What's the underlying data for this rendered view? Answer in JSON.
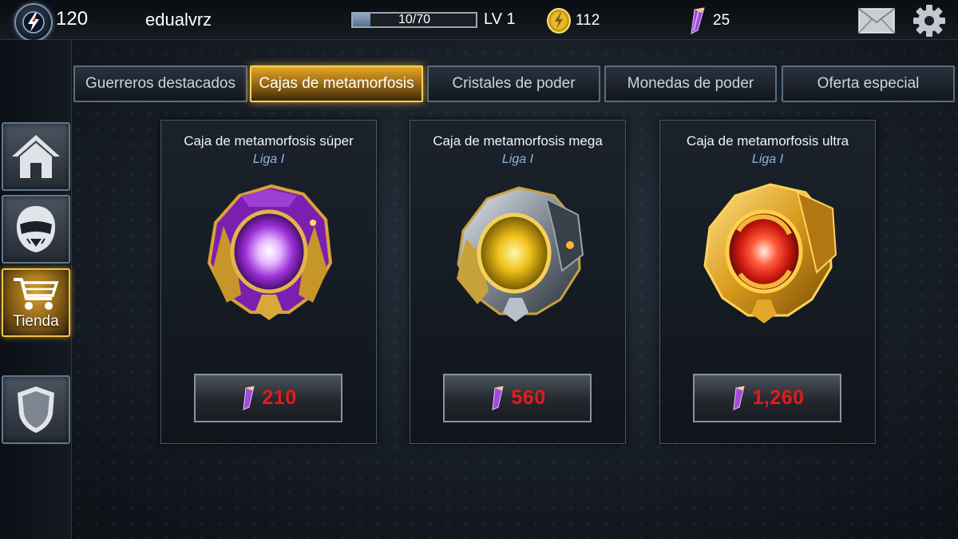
{
  "header": {
    "power_level": "120",
    "username": "edualvrz",
    "xp_text": "10/70",
    "xp_progress": 0.143,
    "level": "LV 1",
    "coins": "112",
    "crystals": "25",
    "icons": [
      "power-emblem-icon",
      "coin-icon",
      "crystal-icon",
      "mail-icon",
      "gear-icon"
    ]
  },
  "sidebar": {
    "items": [
      {
        "id": "home",
        "icon": "home-icon",
        "label": ""
      },
      {
        "id": "rangers",
        "icon": "ranger-helmet-icon",
        "label": ""
      },
      {
        "id": "store",
        "icon": "cart-icon",
        "label": "Tienda",
        "active": true
      },
      {
        "id": "shield",
        "icon": "shield-icon",
        "label": ""
      }
    ]
  },
  "tabs": [
    {
      "label": "Guerreros destacados",
      "active": false
    },
    {
      "label": "Cajas de metamorfosis",
      "active": true
    },
    {
      "label": "Cristales de poder",
      "active": false
    },
    {
      "label": "Monedas de poder",
      "active": false
    },
    {
      "label": "Oferta especial",
      "active": false
    }
  ],
  "cards": [
    {
      "title": "Caja de metamorfosis súper",
      "league": "Liga I",
      "price": "210",
      "theme": "purple"
    },
    {
      "title": "Caja de metamorfosis mega",
      "league": "Liga I",
      "price": "560",
      "theme": "yellow"
    },
    {
      "title": "Caja de metamorfosis ultra",
      "league": "Liga I",
      "price": "1,260",
      "theme": "red"
    }
  ],
  "colors": {
    "accent_gold": "#f2c440",
    "price_red": "#e51a1a",
    "league_blue": "#8fb4df",
    "crystal_purple": "#b45fe0"
  }
}
